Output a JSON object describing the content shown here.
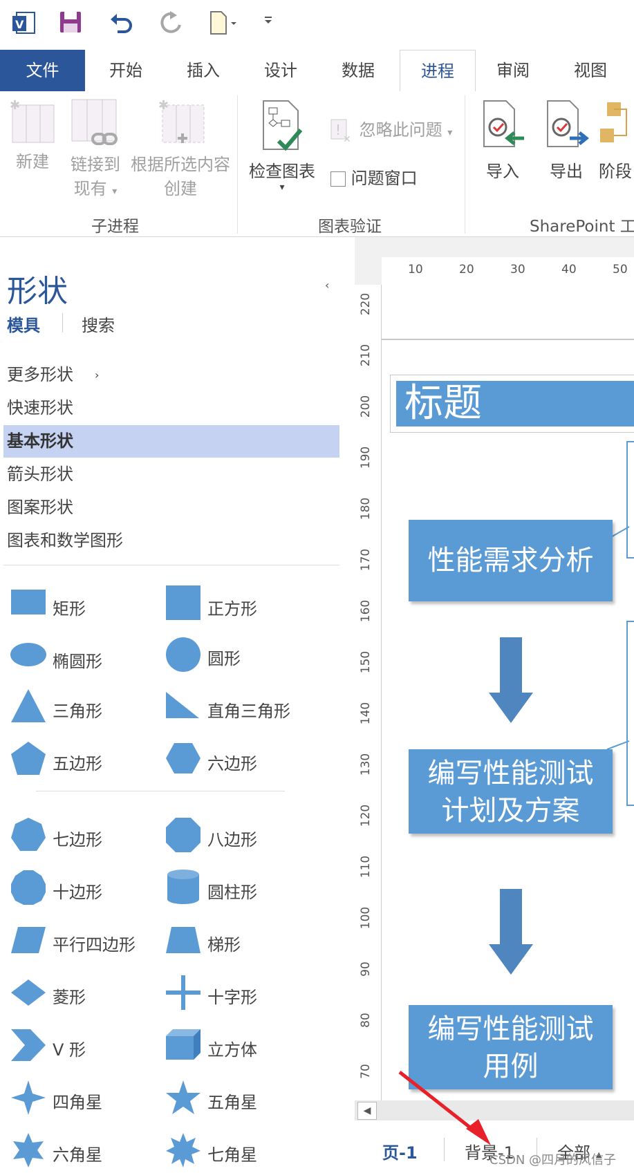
{
  "quick_access": {
    "app_icon": "visio-app-icon",
    "save": "save-icon",
    "undo": "undo-icon",
    "redo": "redo-icon",
    "new": "new-document-icon",
    "customize": "customize-toolbar-icon"
  },
  "tabs": [
    "文件",
    "开始",
    "插入",
    "设计",
    "数据",
    "进程",
    "审阅",
    "视图"
  ],
  "active_tab": "进程",
  "ribbon": {
    "subprocess": {
      "new": "新建",
      "link_line1": "链接到",
      "link_line2": "现有",
      "create_line1": "根据所选内容",
      "create_line2": "创建",
      "group": "子进程"
    },
    "validation": {
      "check_label": "检查图表",
      "ignore_label": "忽略此问题",
      "issues_window": "问题窗口",
      "group": "图表验证"
    },
    "sharepoint": {
      "import": "导入",
      "export": "导出",
      "stage": "阶段",
      "group": "SharePoint 工"
    }
  },
  "shapes_panel": {
    "title": "形状",
    "collapse": "‹",
    "tab_stencils": "模具",
    "tab_search": "搜索",
    "categories": [
      "更多形状",
      "快速形状",
      "基本形状",
      "箭头形状",
      "图案形状",
      "图表和数学图形"
    ],
    "more_arrow": "›",
    "selected_category": "基本形状",
    "items": [
      "矩形",
      "正方形",
      "椭圆形",
      "圆形",
      "三角形",
      "直角三角形",
      "五边形",
      "六边形",
      "七边形",
      "八边形",
      "十边形",
      "圆柱形",
      "平行四边形",
      "梯形",
      "菱形",
      "十字形",
      "V 形",
      "立方体",
      "四角星",
      "五角星",
      "六角星",
      "七角星"
    ]
  },
  "canvas": {
    "ruler_top": [
      "10",
      "20",
      "30",
      "40",
      "50"
    ],
    "ruler_left": [
      "220",
      "210",
      "200",
      "190",
      "180",
      "170",
      "160",
      "150",
      "140",
      "130",
      "120",
      "110",
      "100",
      "90",
      "80",
      "70"
    ],
    "title_shape": "标题",
    "step1": "性能需求分析",
    "step2_line1": "编写性能测试",
    "step2_line2": "计划及方案",
    "step3_line1": "编写性能测试",
    "step3_line2": "用例"
  },
  "page_tabs": {
    "page1": "页-1",
    "background": "背景-1",
    "all": "全部",
    "all_arrow": "▴"
  },
  "watermark": "CSDN @四月的风信子",
  "colors": {
    "accent": "#2b579a",
    "shape_fill": "#5b9bd5",
    "arrow_fill": "#4f86c0",
    "selection": "#c5d2f2",
    "annotation_arrow": "#e8202a"
  }
}
